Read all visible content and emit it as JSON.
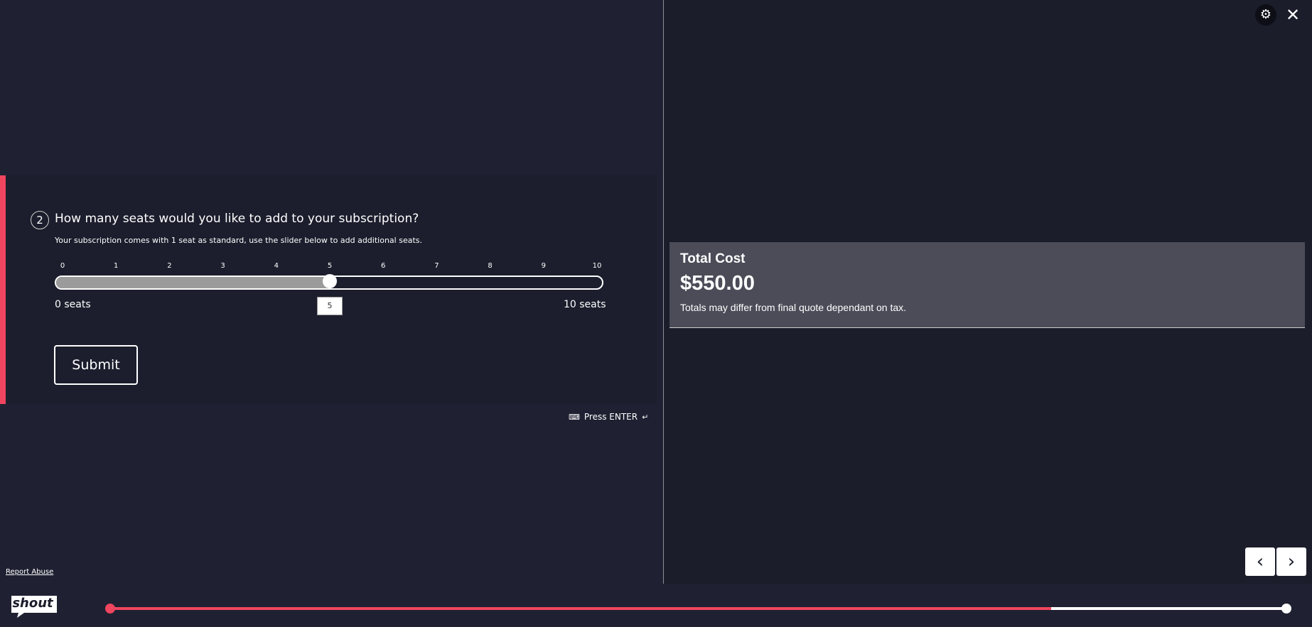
{
  "question": {
    "number": "2",
    "title": "How many seats would you like to add to your subscription?",
    "description": "Your subscription comes with 1 seat as standard, use the slider below to add additional seats.",
    "slider": {
      "ticks": [
        "0",
        "1",
        "2",
        "3",
        "4",
        "5",
        "6",
        "7",
        "8",
        "9",
        "10"
      ],
      "min": 0,
      "max": 10,
      "value": 5,
      "value_display": "5",
      "min_label": "0 seats",
      "max_label": "10 seats"
    },
    "submit_label": "Submit",
    "press_enter_label": "Press ENTER"
  },
  "summary": {
    "title": "Total Cost",
    "amount": "$550.00",
    "note": "Totals may differ from final quote dependant on tax."
  },
  "footer": {
    "report_abuse_label": "Report Abuse",
    "logo_text": "shout",
    "progress_fraction": 0.8
  },
  "icons": {
    "settings": "gear-icon",
    "close": "close-icon",
    "prev": "chevron-left-icon",
    "next": "chevron-right-icon",
    "keyboard": "keyboard-icon",
    "enter": "enter-key-icon"
  },
  "colors": {
    "accent": "#f0455f",
    "background": "#1f2132",
    "card": "#4b4c58",
    "slider_fill": "#9b9b9b"
  }
}
